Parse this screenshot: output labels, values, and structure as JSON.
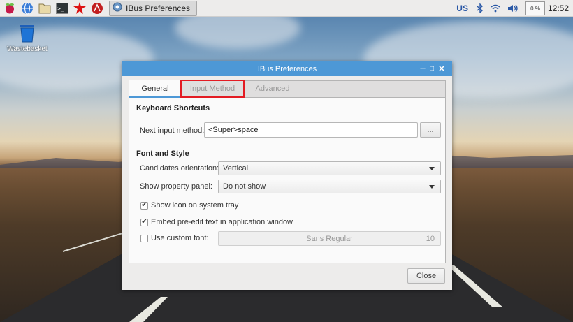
{
  "taskbar": {
    "task_title": "IBus Preferences",
    "keyboard_layout": "US",
    "cpu_usage": "0 %",
    "clock": "12:52"
  },
  "desktop": {
    "icons": [
      {
        "label": "Wastebasket",
        "icon": "trash-icon"
      }
    ]
  },
  "window": {
    "title": "IBus Preferences",
    "tabs": [
      {
        "label": "General",
        "active": true
      },
      {
        "label": "Input Method",
        "active": false,
        "highlighted": true
      },
      {
        "label": "Advanced",
        "active": false
      }
    ],
    "keyboard_shortcuts": {
      "heading": "Keyboard Shortcuts",
      "next_label": "Next input method:",
      "next_value": "<Super>space",
      "browse_label": "..."
    },
    "font_style": {
      "heading": "Font and Style",
      "orientation_label": "Candidates orientation:",
      "orientation_value": "Vertical",
      "panel_label": "Show property panel:",
      "panel_value": "Do not show",
      "show_icon_label": "Show icon on system tray",
      "show_icon_checked": true,
      "embed_label": "Embed pre-edit text in application window",
      "embed_checked": true,
      "custom_font_label": "Use custom font:",
      "custom_font_checked": false,
      "font_name": "Sans Regular",
      "font_size": "10"
    },
    "close_label": "Close"
  },
  "colors": {
    "titlebar": "#4d98d6",
    "highlight": "#e31b23"
  }
}
